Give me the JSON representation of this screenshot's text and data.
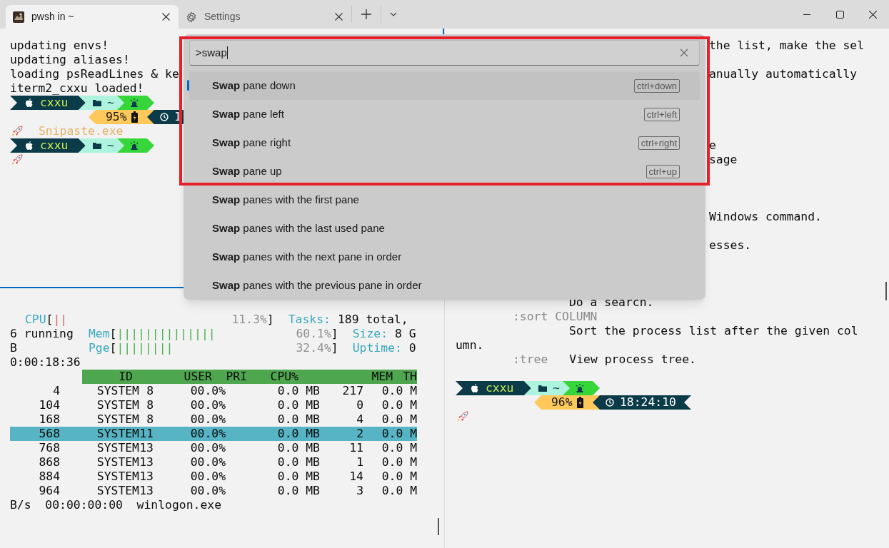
{
  "tabs": [
    {
      "kind": "shell",
      "title": "pwsh in ~",
      "selected": true
    },
    {
      "kind": "settings",
      "title": "Settings",
      "selected": false
    }
  ],
  "top_left_pane": {
    "focused": true,
    "lines": [
      {
        "kind": "text",
        "text": "updating envs!"
      },
      {
        "kind": "text",
        "text": "updating aliases!"
      },
      {
        "kind": "text",
        "text": "loading psReadLines & ke"
      },
      {
        "kind": "text",
        "text": "iterm2_cxxu loaded!"
      },
      {
        "kind": "prompt",
        "user": "cxxu",
        "dir": "~",
        "battery": "95%",
        "time": "1"
      },
      {
        "kind": "rocket",
        "text": "Snipaste.exe"
      },
      {
        "kind": "prompt",
        "user": "cxxu",
        "dir": "~"
      },
      {
        "kind": "rocket"
      }
    ]
  },
  "bottom_left_pane": {
    "focused": false,
    "meters": [
      {
        "label": "CPU",
        "open": "[",
        "bar": "||",
        "reading": "11.3%",
        "close": "]",
        "kind": "cpu"
      },
      {
        "label": "Mem",
        "open": "[",
        "bar": "||||||||||||||",
        "reading": "60.1%",
        "close": "]",
        "kind": "memory"
      },
      {
        "label": "Pge",
        "open": "[",
        "bar": "||||||||",
        "reading": "32.4%",
        "close": "]",
        "kind": "memory"
      }
    ],
    "stats": [
      {
        "label": "Tasks:",
        "value": "189 total,"
      },
      {
        "label": "Size:",
        "value": "8 G"
      },
      {
        "label": "Uptime:",
        "value": "0"
      }
    ],
    "wrapped": [
      "6 running",
      "B",
      "0:00:18:36"
    ],
    "header_bar": [
      "ID",
      "USER",
      "PRI",
      "CPU%",
      "MEM",
      "TH"
    ],
    "process_lines": [
      {
        "values": [
          "4",
          "SYSTEM",
          "8",
          "00.0%",
          "0.0 MB",
          "217",
          "0.0 M"
        ],
        "selected": false
      },
      {
        "values": [
          "104",
          "SYSTEM",
          "8",
          "00.0%",
          "0.0 MB",
          "0",
          "0.0 M"
        ],
        "selected": false
      },
      {
        "values": [
          "168",
          "SYSTEM",
          "8",
          "00.0%",
          "0.0 MB",
          "4",
          "0.0 M"
        ],
        "selected": false
      },
      {
        "values": [
          "568",
          "SYSTEM",
          "11",
          "00.0%",
          "0.0 MB",
          "2",
          "0.0 M"
        ],
        "selected": true
      },
      {
        "values": [
          "768",
          "SYSTEM",
          "13",
          "00.0%",
          "0.0 MB",
          "11",
          "0.0 M"
        ],
        "selected": false
      },
      {
        "values": [
          "868",
          "SYSTEM",
          "13",
          "00.0%",
          "0.0 MB",
          "1",
          "0.0 M"
        ],
        "selected": false
      },
      {
        "values": [
          "884",
          "SYSTEM",
          "13",
          "00.0%",
          "0.0 MB",
          "14",
          "0.0 M"
        ],
        "selected": false
      },
      {
        "values": [
          "964",
          "SYSTEM",
          "13",
          "00.0%",
          "0.0 MB",
          "3",
          "0.0 M"
        ],
        "selected": false
      }
    ],
    "footer": "B/s  00:00:00:00  winlogon.exe"
  },
  "right_pane": {
    "focused": false,
    "lines": [
      {
        "text": "the list, make the sel",
        "dim": false
      },
      {
        "text": "anually automatically",
        "dim": false
      },
      {
        "text": "e",
        "dim": false
      },
      {
        "text": "sage",
        "dim": false
      },
      {
        "text": "Windows command.",
        "dim": false
      },
      {
        "text": "esses.",
        "dim": false
      },
      {
        "text": "Do a search.",
        "dim": false
      },
      {
        "text": ":sort COLUMN",
        "dim": true
      },
      {
        "text": "Sort the process list after the given col",
        "dim": false
      },
      {
        "text": "umn.",
        "dim": false
      },
      {
        "text": ":tree",
        "dim": true
      },
      {
        "text": "View process tree.",
        "dim": false
      }
    ],
    "prompt": {
      "user": "cxxu",
      "dir": "~",
      "battery": "96%",
      "time": "18:24:10"
    }
  },
  "command_palette": {
    "query": ">swap",
    "highlight_frame": true,
    "items": [
      {
        "label": "**Swap** pane down",
        "key": "ctrl+down",
        "selected": true
      },
      {
        "label": "**Swap** pane left",
        "key": "ctrl+left",
        "selected": false
      },
      {
        "label": "**Swap** pane right",
        "key": "ctrl+right",
        "selected": false
      },
      {
        "label": "**Swap** pane up",
        "key": "ctrl+up",
        "selected": false
      },
      {
        "label": "**Swap** panes with the first pane",
        "selected": false
      },
      {
        "label": "**Swap** panes with the last used pane",
        "selected": false
      },
      {
        "label": "**Swap** panes with the next pane in order",
        "selected": false
      },
      {
        "label": "**Swap** panes with the previous pane in order",
        "selected": false
      }
    ]
  }
}
